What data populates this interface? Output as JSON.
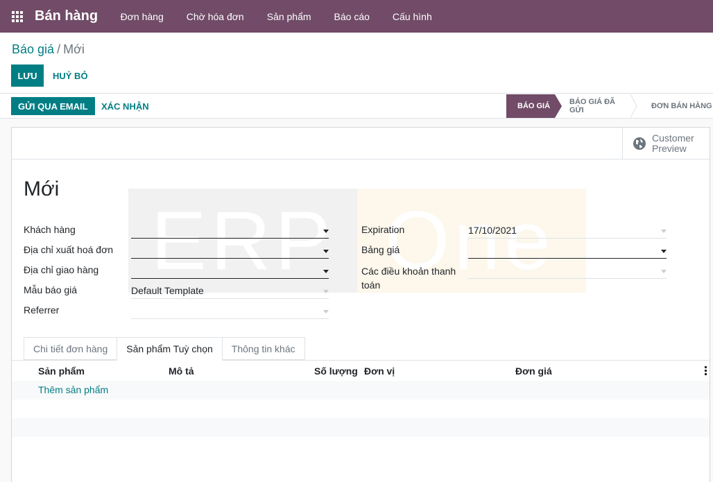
{
  "navbar": {
    "app_name": "Bán hàng",
    "menu": [
      "Đơn hàng",
      "Chờ hóa đơn",
      "Sản phẩm",
      "Báo cáo",
      "Cấu hình"
    ]
  },
  "breadcrumb": {
    "parent": "Báo giá",
    "separator": "/",
    "current": "Mới"
  },
  "actions": {
    "save": "LƯU",
    "discard": "HUỶ BỎ"
  },
  "statusbar": {
    "send_email": "GỬI QUA EMAIL",
    "confirm": "XÁC NHẬN",
    "stages": [
      "BÁO GIÁ",
      "BÁO GIÁ ĐÃ GỬI",
      "ĐƠN BÁN HÀNG"
    ],
    "active_stage": "BÁO GIÁ"
  },
  "preview": {
    "label": "Customer Preview"
  },
  "watermark": {
    "text_left": "ERP",
    "text_right": "One"
  },
  "form": {
    "title": "Mới",
    "left": {
      "customer_label": "Khách hàng",
      "invoice_addr_label": "Địa chỉ xuất hoá đơn",
      "delivery_addr_label": "Địa chỉ giao hàng",
      "template_label": "Mẫu báo giá",
      "template_value": "Default Template",
      "referrer_label": "Referrer"
    },
    "right": {
      "expiration_label": "Expiration",
      "expiration_value": "17/10/2021",
      "pricelist_label": "Bảng giá",
      "payment_terms_label": "Các điều khoản thanh toán"
    }
  },
  "tabs": [
    "Chi tiết đơn hàng",
    "Sản phẩm Tuỳ chọn",
    "Thông tin khác"
  ],
  "active_tab": "Sản phẩm Tuỳ chọn",
  "table": {
    "columns": [
      "Sản phẩm",
      "Mô tả",
      "Số lượng",
      "Đơn vị",
      "Đơn giá"
    ],
    "add_line": "Thêm sản phẩm"
  },
  "colors": {
    "brand": "#714b67",
    "accent": "#017e84"
  }
}
